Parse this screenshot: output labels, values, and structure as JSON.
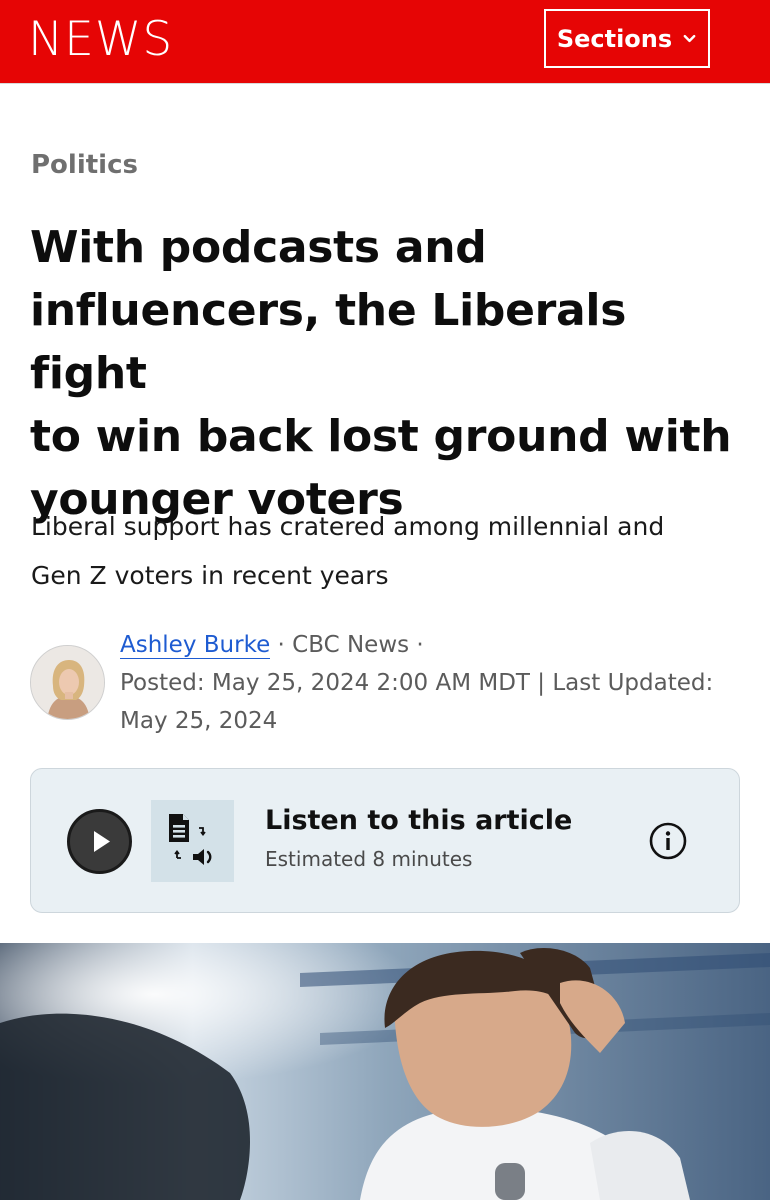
{
  "header": {
    "logo": "NEWS",
    "sections_label": "Sections",
    "brand_color": "#e60505"
  },
  "article": {
    "category": "Politics",
    "headline_lines": [
      "With podcasts and",
      "influencers, the Liberals fight",
      "to win back lost ground with",
      "younger voters"
    ],
    "deck_lines": [
      "Liberal support has cratered among millennial and",
      "Gen Z voters in recent years"
    ],
    "byline": {
      "author": "Ashley Burke",
      "separator1": " · ",
      "outlet": "CBC News",
      "separator2": " ·",
      "posted_line": "Posted: May 25, 2024 2:00 AM MDT | Last Updated:",
      "updated_line": "May 25, 2024"
    }
  },
  "listen": {
    "title": "Listen to this article",
    "subtitle": "Estimated 8 minutes",
    "icons": [
      "play-icon",
      "text-to-speech-icon",
      "info-icon"
    ]
  },
  "hero_image": {
    "icon": "photo"
  }
}
